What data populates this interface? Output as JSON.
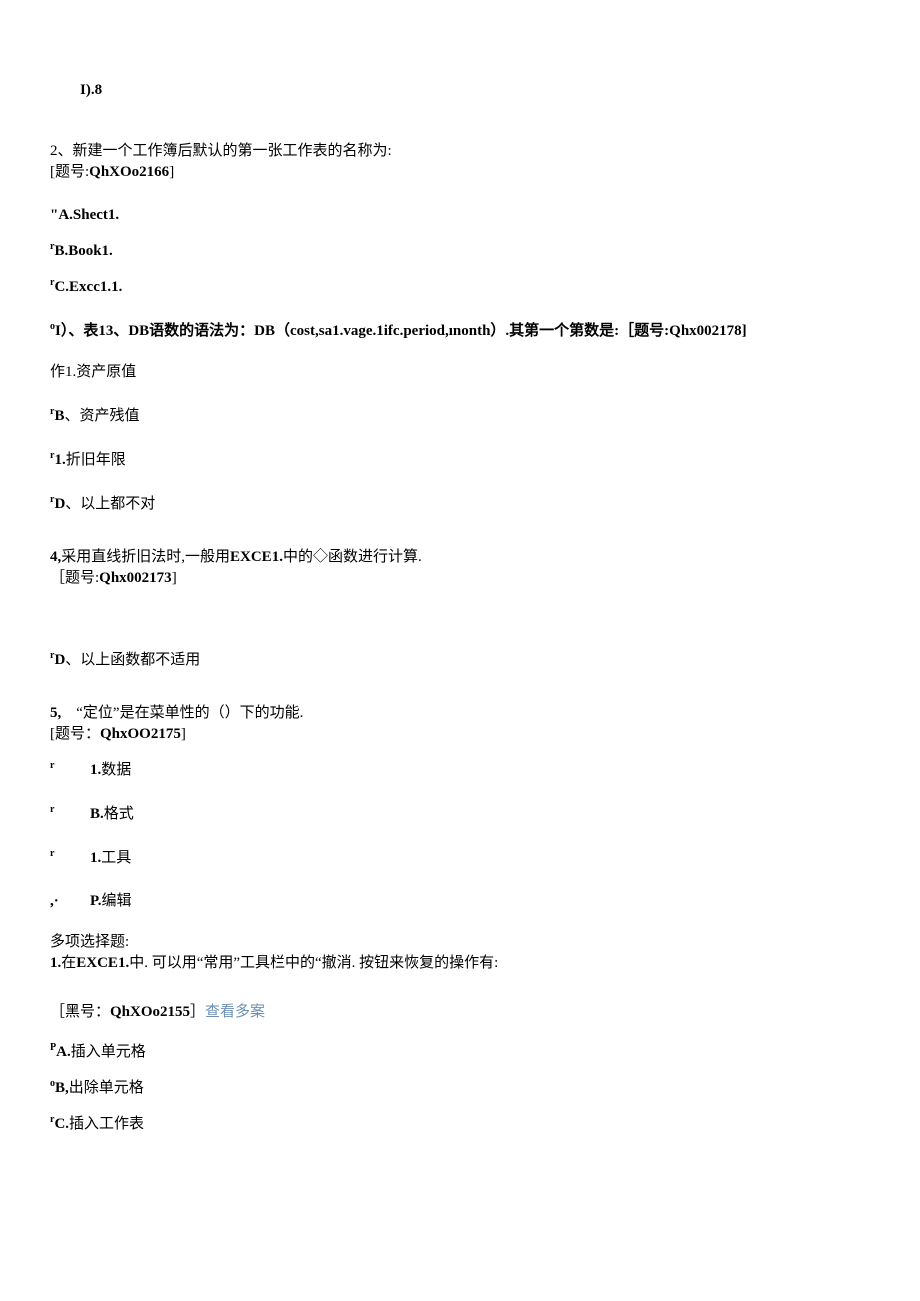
{
  "q1_opt_d": "I).8",
  "q2": {
    "prompt": "2、新建一个工作簿后默认的第一张工作表的名称为:",
    "code": "[题号:QhXOo2166]",
    "a": "\"A.Shect1.",
    "b_sup": "r",
    "b": "B.Book1.",
    "c_sup": "r",
    "c": "C.Excc1.1."
  },
  "q3": {
    "sup": "o",
    "prompt": "I）、表13、DB语数的语法为：DB（cost,sa1.vage.1ifc.period,ınonth）.其第一个第数是:［题号:Qhx002178]",
    "a": "作1.资产原值",
    "b_sup": "r",
    "b": "B、资产残值",
    "c_sup": "r",
    "c": "1.折旧年限",
    "d_sup": "r",
    "d": "D、以上都不对"
  },
  "q4": {
    "prompt": "4,采用直线折旧法时,一般用EXCE1.中的◇函数进行计算.",
    "code": "［题号:Qhx002173]",
    "d_sup": "r",
    "d": "D、以上函数都不适用"
  },
  "q5": {
    "num": "5,",
    "prompt": "“定位”是在菜单性的（）下的功能.",
    "code": "[题号：QhxOO2175]",
    "a_sup": "r",
    "a": "1.数据",
    "b_sup": "r",
    "b": "B.格式",
    "c_sup": "r",
    "c": "1.工具",
    "d_sup": ",·",
    "d": "P.编辑"
  },
  "multi": {
    "header": "多项选择题:",
    "q1_prompt": "1.在EXCE1.中. 可以用“常用”工具栏中的“撤消. 按钮来恢复的操作有:",
    "q1_code_pre": "［黑号：QhXOo2155］",
    "q1_link": "查看多案",
    "a_sup": "P",
    "a": "A.插入单元格",
    "b_sup": "o",
    "b": "B,出除单元格",
    "c_sup": "r",
    "c": "C.插入工作表"
  }
}
